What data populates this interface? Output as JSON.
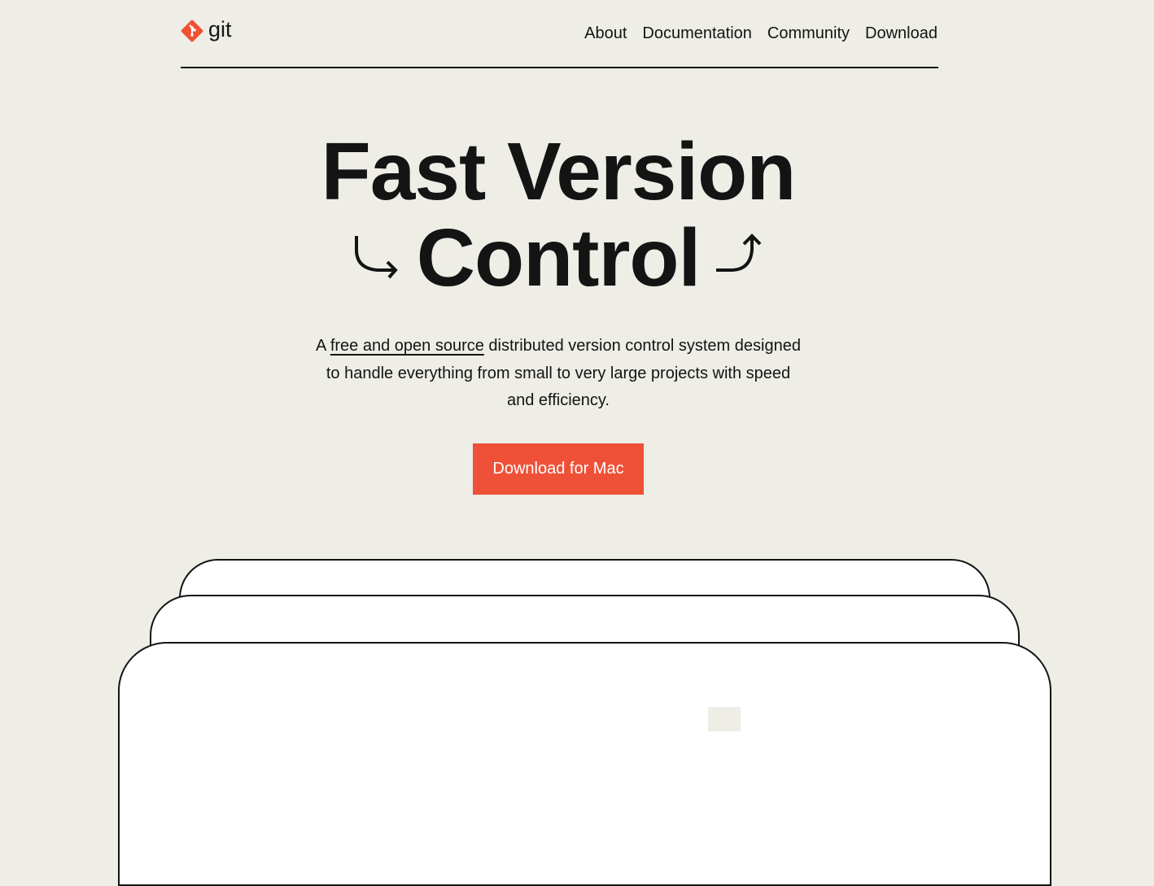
{
  "brand": {
    "name": "git",
    "color": "#f05133"
  },
  "nav": {
    "items": [
      {
        "label": "About"
      },
      {
        "label": "Documentation"
      },
      {
        "label": "Community"
      },
      {
        "label": "Download"
      }
    ]
  },
  "hero": {
    "title_line1": "Fast Version",
    "title_line2": "Control",
    "desc_prefix": "A ",
    "desc_link": "free and open source",
    "desc_rest": " distributed version control system designed to handle everything from small to very large projects with speed and efficiency.",
    "cta": "Download for Mac",
    "cta_color": "#ee5138"
  }
}
